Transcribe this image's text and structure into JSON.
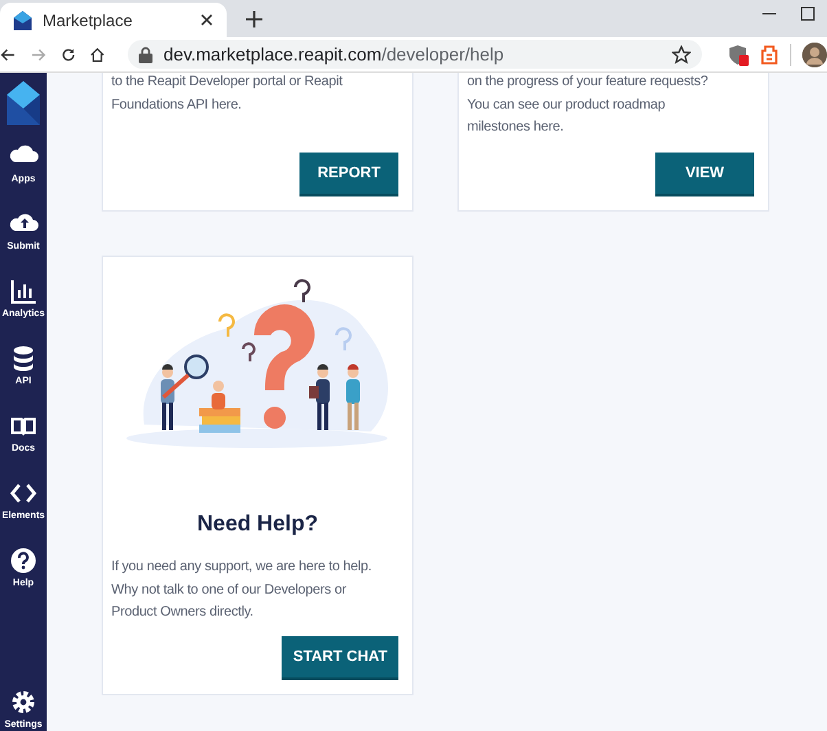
{
  "browser": {
    "tabs": [
      {
        "title": "Marketplace",
        "selected": true
      }
    ],
    "address": {
      "domain": "dev.marketplace.reapit.com",
      "path": "/developer/help"
    }
  },
  "sidebar": {
    "items": [
      {
        "label": "Apps",
        "kind": "cloud"
      },
      {
        "label": "Submit",
        "kind": "upload"
      },
      {
        "label": "Analytics",
        "kind": "chart"
      },
      {
        "label": "API",
        "kind": "database"
      },
      {
        "label": "Docs",
        "kind": "book"
      },
      {
        "label": "Elements",
        "kind": "code"
      },
      {
        "label": "Help",
        "kind": "help"
      },
      {
        "label": "Settings",
        "kind": "gear"
      }
    ]
  },
  "cards": [
    {
      "kind": "text",
      "lines": [
        "to the Reapit Developer portal or Reapit",
        "Foundations API here."
      ],
      "button": "REPORT"
    },
    {
      "kind": "text",
      "lines": [
        "on the progress of your feature requests?",
        "You can see our product roadmap",
        "milestones here."
      ],
      "button": "VIEW"
    },
    {
      "kind": "illustrated",
      "title": "Need Help?",
      "lines": [
        "If you need any support, we are here to help.",
        "Why not talk to one of our Developers or",
        "Product Owners directly."
      ],
      "button": "START CHAT"
    }
  ]
}
